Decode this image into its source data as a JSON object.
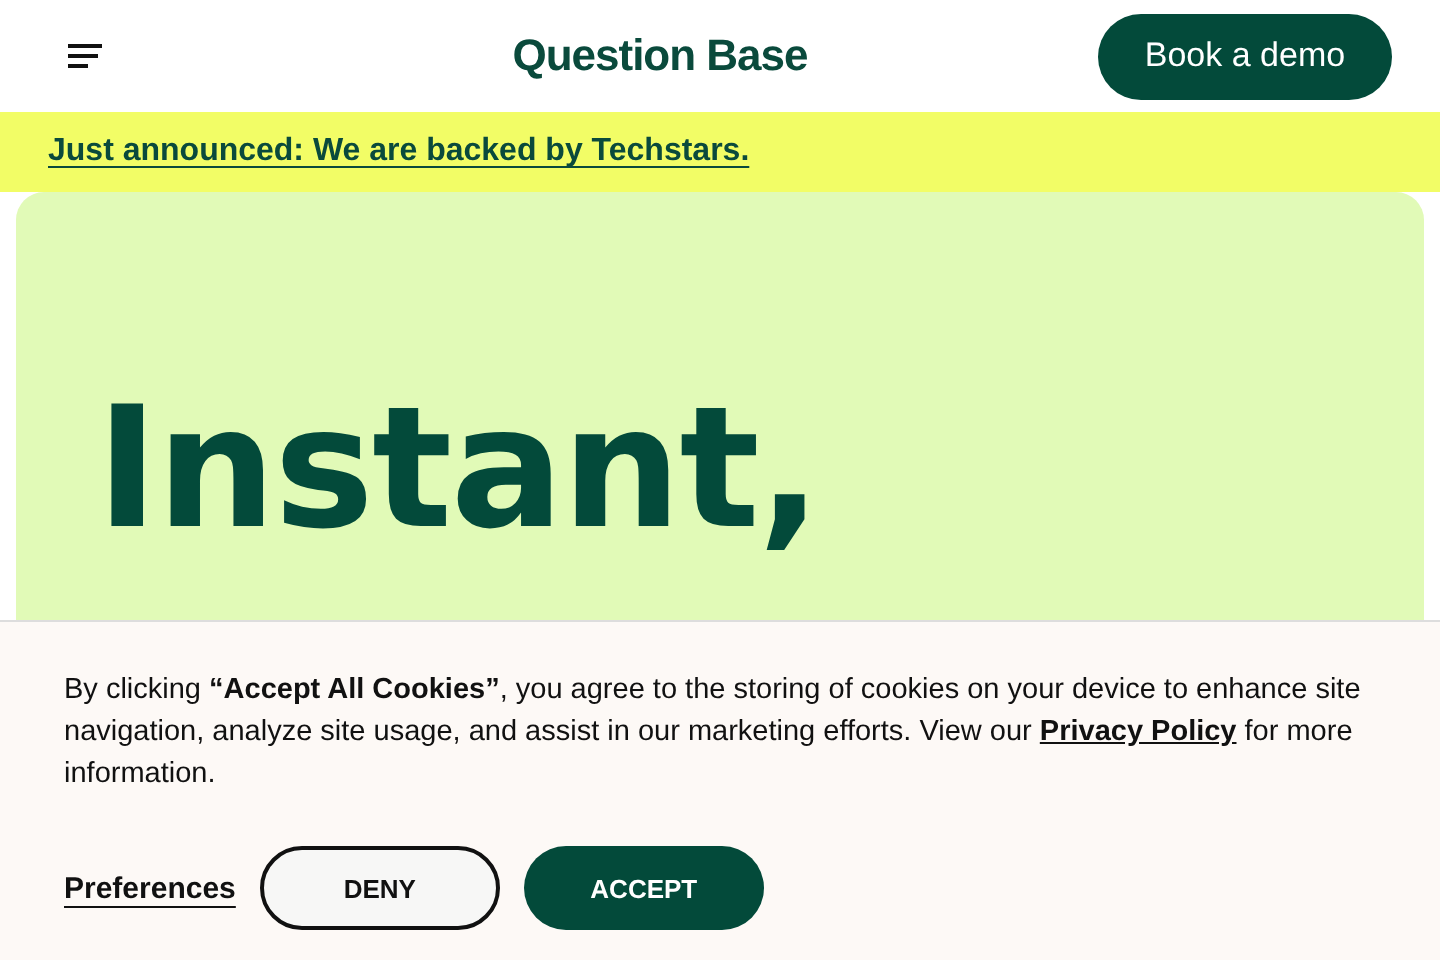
{
  "header": {
    "logo": "Question Base",
    "cta": "Book a demo"
  },
  "announcement": {
    "link": "Just announced: We are backed by Techstars."
  },
  "hero": {
    "heading": "Instant,"
  },
  "cookie_banner": {
    "text_before": "By clicking **“Accept All Cookies”**, you agree to the storing of cookies on your device to enhance site navigation, analyze site usage, and assist in our marketing efforts. View our",
    "policy_link": "Privacy Policy",
    "text_after": "for more information.",
    "buttons": [
      {
        "kind": "link",
        "label": "Preferences"
      },
      {
        "kind": "outline",
        "label": "DENY"
      },
      {
        "kind": "filled",
        "label": "ACCEPT"
      }
    ]
  }
}
